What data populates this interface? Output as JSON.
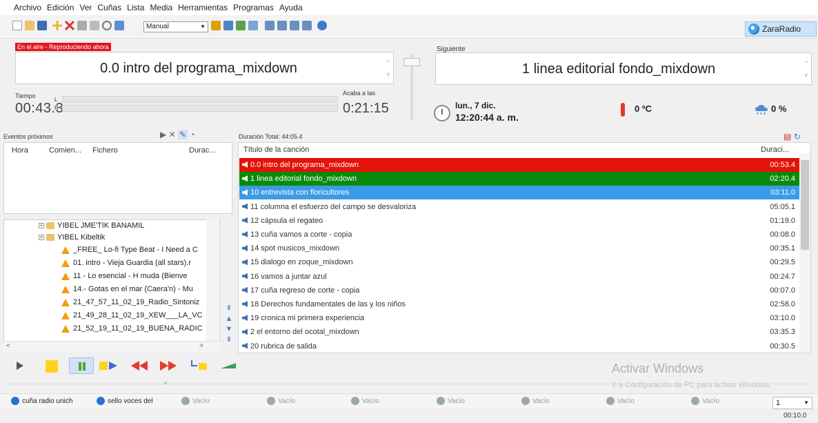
{
  "menu": [
    "Archivo",
    "Edición",
    "Ver",
    "Cuñas",
    "Lista",
    "Media",
    "Herramientas",
    "Programas",
    "Ayuda"
  ],
  "toolbar": {
    "mode": "Manual",
    "brand": "ZaraRadio"
  },
  "onair": {
    "badge": "En el aire - Reproduciendo ahora",
    "title": "0.0 intro del programa_mixdown"
  },
  "next": {
    "label": "Siguiente",
    "title": "1 linea editorial fondo_mixdown"
  },
  "timer": {
    "tiempo_label": "Tiempo",
    "tiempo_value": "00:43.3",
    "left_label": "L",
    "right_label": "R",
    "acaba_label": "Acaba a las",
    "acaba_value": "0:21:15"
  },
  "info": {
    "date": "lun., 7 dic.",
    "time": "12:20:44 a. m.",
    "temperature": "0 ºC",
    "humidity": "0 %"
  },
  "events": {
    "title": "Eventos próximos",
    "col_hora": "Hora",
    "col_comienza": "Comien...",
    "col_fichero": "Fichero",
    "col_duracion": "Durac..."
  },
  "tree": [
    {
      "label": "YIBEL JME'TIK BANAMIL",
      "type": "folder"
    },
    {
      "label": "YIBEL Kibeltik",
      "type": "folder"
    },
    {
      "label": "_FREE_ Lo-fi Type Beat - I Need a C",
      "type": "file"
    },
    {
      "label": "01. intro - Vieja Guardia (all stars).r",
      "type": "file"
    },
    {
      "label": "11 - Lo esencial - H muda  (Bienve",
      "type": "file"
    },
    {
      "label": "14.- Gotas en el mar (Caera'n) - Mu",
      "type": "file"
    },
    {
      "label": "21_47_57_11_02_19_Radio_Sintoniz",
      "type": "file"
    },
    {
      "label": "21_49_28_11_02_19_XEW___LA_VC",
      "type": "file"
    },
    {
      "label": "21_52_19_11_02_19_BUENA_RADIC",
      "type": "file"
    }
  ],
  "playlist": {
    "total": "Duración Total: 44:05.4",
    "col_title": "Título de la canción",
    "col_duration": "Duraci...",
    "rows": [
      {
        "title": "0.0 intro del programa_mixdown",
        "duration": "00:53.4",
        "state": "playing"
      },
      {
        "title": "1 linea editorial fondo_mixdown",
        "duration": "02:20.4",
        "state": "next"
      },
      {
        "title": "10 entrevista con floricultores",
        "duration": "03:11.0",
        "state": "selected"
      },
      {
        "title": "11 columna el esfuerzo del campo se desvaloriza",
        "duration": "05:05.1",
        "state": ""
      },
      {
        "title": "12 cápsula el regateo",
        "duration": "01:19.0",
        "state": ""
      },
      {
        "title": "13 cuña vamos a corte - copia",
        "duration": "00:08.0",
        "state": ""
      },
      {
        "title": "14 spot musicos_mixdown",
        "duration": "00:35.1",
        "state": ""
      },
      {
        "title": "15 dialogo en zoque_mixdown",
        "duration": "00:29.5",
        "state": ""
      },
      {
        "title": "16 vamos a juntar azul",
        "duration": "00:24.7",
        "state": ""
      },
      {
        "title": "17 cuña regreso de corte - copia",
        "duration": "00:07.0",
        "state": ""
      },
      {
        "title": "18 Derechos fundamentales de las y los niños",
        "duration": "02:58.0",
        "state": ""
      },
      {
        "title": "19 cronica mi primera experiencia",
        "duration": "03:10.0",
        "state": ""
      },
      {
        "title": "2 el entorno del ocotal_mixdown",
        "duration": "03:35.3",
        "state": ""
      },
      {
        "title": "20 rubrica de salida",
        "duration": "00:30.5",
        "state": ""
      }
    ]
  },
  "watermark": {
    "line1": "Activar Windows",
    "line2": "Ir a Configuración de PC para activar Windows."
  },
  "carts": [
    {
      "label": "cuña radio unich",
      "empty": false
    },
    {
      "label": "sello voces del",
      "empty": false
    },
    {
      "label": "Vacío",
      "empty": true
    },
    {
      "label": "Vacío",
      "empty": true
    },
    {
      "label": "Vacío",
      "empty": true
    },
    {
      "label": "Vacío",
      "empty": true
    },
    {
      "label": "Vacío",
      "empty": true
    },
    {
      "label": "Vacío",
      "empty": true
    },
    {
      "label": "Vacío",
      "empty": true
    }
  ],
  "page_select": "1",
  "elapsed": "00:10.0",
  "colors": {
    "playing": "#e3120b",
    "next": "#0a8a0a",
    "selected": "#3c9be6",
    "onair_badge": "#e0181e"
  }
}
